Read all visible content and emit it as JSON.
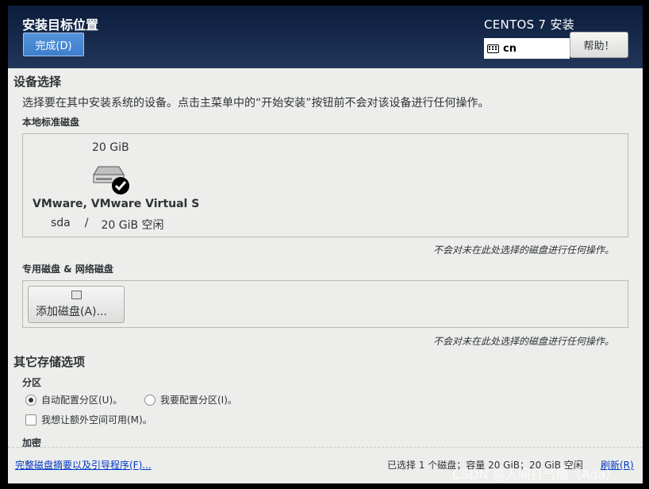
{
  "header": {
    "title": "安装目标位置",
    "done_label": "完成(D)",
    "product": "CENTOS 7 安装",
    "keyboard_layout": "cn",
    "help_label": "帮助！"
  },
  "device_selection": {
    "heading": "设备选择",
    "description": "选择要在其中安装系统的设备。点击主菜单中的“开始安装”按钮前不会对该设备进行任何操作。",
    "local_disks_label": "本地标准磁盘",
    "disk": {
      "size": "20 GiB",
      "name": "VMware, VMware Virtual S",
      "device": "sda",
      "separator": "/",
      "free": "20 GiB 空闲",
      "selected": true
    },
    "local_note": "不会对未在此处选择的磁盘进行任何操作。",
    "specialized_label": "专用磁盘 & 网络磁盘",
    "add_disk_label": "添加磁盘(A)...",
    "specialized_note": "不会对未在此处选择的磁盘进行任何操作。"
  },
  "other_storage": {
    "heading": "其它存储选项",
    "partition_label": "分区",
    "auto_partition": "自动配置分区(U)。",
    "manual_partition": "我要配置分区(I)。",
    "extra_space": "我想让额外空间可用(M)。",
    "encryption_label": "加密"
  },
  "footer": {
    "summary_link": "完整磁盘摘要以及引导程序(F)...",
    "status": "已选择 1 个磁盘；容量 20 GiB；20 GiB 空闲",
    "refresh_link": "刷新(R)"
  },
  "watermark": "CSDN @人间打气筒（Ada）",
  "colors": {
    "header_bg": "#0b1d3c",
    "done_button": "#4a89d4",
    "link": "#0037c6",
    "background": "#ededec"
  }
}
